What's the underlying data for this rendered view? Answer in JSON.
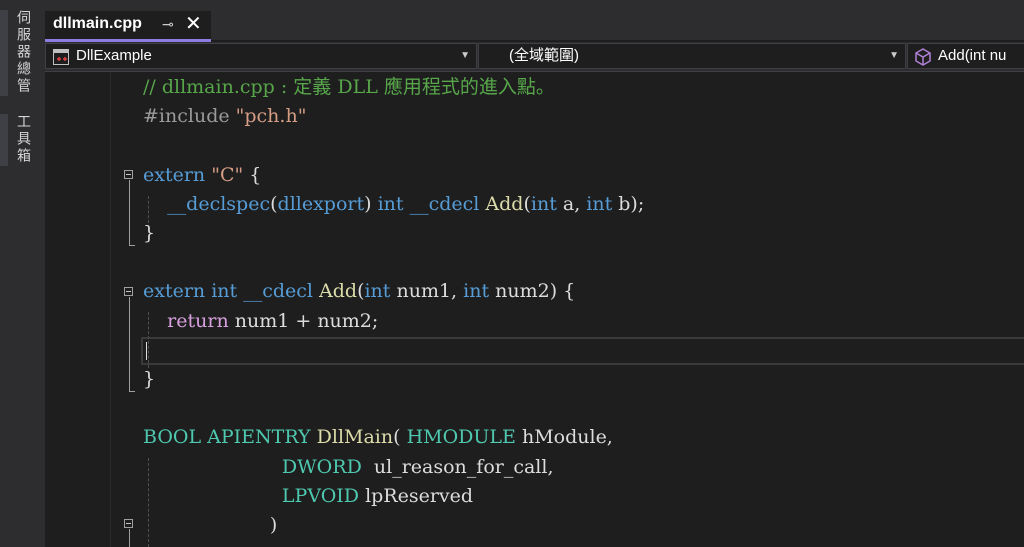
{
  "sidebar": {
    "tabs": [
      {
        "label": "伺服器總管"
      },
      {
        "label": "工具箱"
      }
    ]
  },
  "tab": {
    "title": "dllmain.cpp",
    "pin_icon": "pin-icon",
    "close_icon": "close-icon"
  },
  "navbar": {
    "project": "DllExample",
    "scope": "(全域範圍)",
    "member": "Add(int nu"
  },
  "code": {
    "lines": [
      [
        {
          "t": "// dllmain.cpp : 定義 DLL 應用程式的進入點。",
          "c": "comment"
        }
      ],
      [
        {
          "t": "#include ",
          "c": "pre"
        },
        {
          "t": "\"pch.h\"",
          "c": "str"
        }
      ],
      [],
      [
        {
          "t": "extern ",
          "c": "kw"
        },
        {
          "t": "\"C\"",
          "c": "str"
        },
        {
          "t": " {",
          "c": "plain"
        }
      ],
      [
        {
          "t": "    ",
          "c": "plain"
        },
        {
          "t": "__declspec",
          "c": "kw"
        },
        {
          "t": "(",
          "c": "plain"
        },
        {
          "t": "dllexport",
          "c": "kw"
        },
        {
          "t": ") ",
          "c": "plain"
        },
        {
          "t": "int",
          "c": "kw"
        },
        {
          "t": " ",
          "c": "plain"
        },
        {
          "t": "__cdecl",
          "c": "kw"
        },
        {
          "t": " ",
          "c": "plain"
        },
        {
          "t": "Add",
          "c": "fn"
        },
        {
          "t": "(",
          "c": "plain"
        },
        {
          "t": "int",
          "c": "kw"
        },
        {
          "t": " a, ",
          "c": "plain"
        },
        {
          "t": "int",
          "c": "kw"
        },
        {
          "t": " b);",
          "c": "plain"
        }
      ],
      [
        {
          "t": "}",
          "c": "plain"
        }
      ],
      [],
      [
        {
          "t": "extern ",
          "c": "kw"
        },
        {
          "t": "int",
          "c": "kw"
        },
        {
          "t": " ",
          "c": "plain"
        },
        {
          "t": "__cdecl",
          "c": "kw"
        },
        {
          "t": " ",
          "c": "plain"
        },
        {
          "t": "Add",
          "c": "fn"
        },
        {
          "t": "(",
          "c": "plain"
        },
        {
          "t": "int",
          "c": "kw"
        },
        {
          "t": " num1, ",
          "c": "plain"
        },
        {
          "t": "int",
          "c": "kw"
        },
        {
          "t": " num2) {",
          "c": "plain"
        }
      ],
      [
        {
          "t": "    ",
          "c": "plain"
        },
        {
          "t": "return",
          "c": "ctl"
        },
        {
          "t": " num1 + num2;",
          "c": "plain"
        }
      ],
      [],
      [
        {
          "t": "}",
          "c": "plain"
        }
      ],
      [],
      [
        {
          "t": "BOOL",
          "c": "type"
        },
        {
          "t": " ",
          "c": "plain"
        },
        {
          "t": "APIENTRY",
          "c": "type"
        },
        {
          "t": " ",
          "c": "plain"
        },
        {
          "t": "DllMain",
          "c": "fn"
        },
        {
          "t": "( ",
          "c": "plain"
        },
        {
          "t": "HMODULE",
          "c": "type"
        },
        {
          "t": " hModule,",
          "c": "plain"
        }
      ],
      [
        {
          "t": "                       ",
          "c": "plain"
        },
        {
          "t": "DWORD",
          "c": "type"
        },
        {
          "t": "  ul_reason_for_call,",
          "c": "plain"
        }
      ],
      [
        {
          "t": "                       ",
          "c": "plain"
        },
        {
          "t": "LPVOID",
          "c": "type"
        },
        {
          "t": " lpReserved",
          "c": "plain"
        }
      ],
      [
        {
          "t": "                     )",
          "c": "plain"
        }
      ]
    ]
  }
}
